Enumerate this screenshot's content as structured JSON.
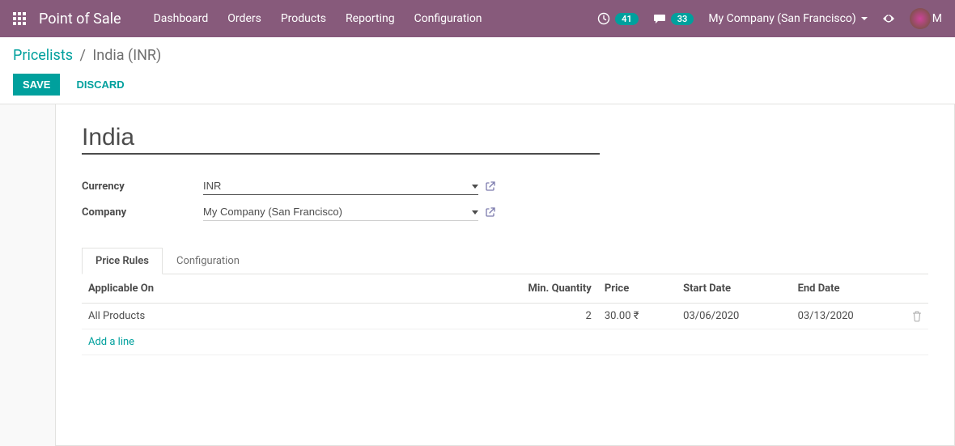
{
  "navbar": {
    "brand": "Point of Sale",
    "menu": [
      "Dashboard",
      "Orders",
      "Products",
      "Reporting",
      "Configuration"
    ],
    "activity_count": "41",
    "message_count": "33",
    "company": "My Company (San Francisco)",
    "user_initial": "M"
  },
  "breadcrumb": {
    "parent": "Pricelists",
    "current": "India (INR)"
  },
  "buttons": {
    "save": "Save",
    "discard": "Discard"
  },
  "form": {
    "title": "India",
    "currency_label": "Currency",
    "currency_value": "INR",
    "company_label": "Company",
    "company_value": "My Company (San Francisco)"
  },
  "tabs": {
    "price_rules": "Price Rules",
    "configuration": "Configuration"
  },
  "table": {
    "headers": {
      "applicable_on": "Applicable On",
      "min_qty": "Min. Quantity",
      "price": "Price",
      "start_date": "Start Date",
      "end_date": "End Date"
    },
    "rows": [
      {
        "applicable_on": "All Products",
        "min_qty": "2",
        "price": "30.00 ₹",
        "start_date": "03/06/2020",
        "end_date": "03/13/2020"
      }
    ],
    "add_line": "Add a line"
  }
}
